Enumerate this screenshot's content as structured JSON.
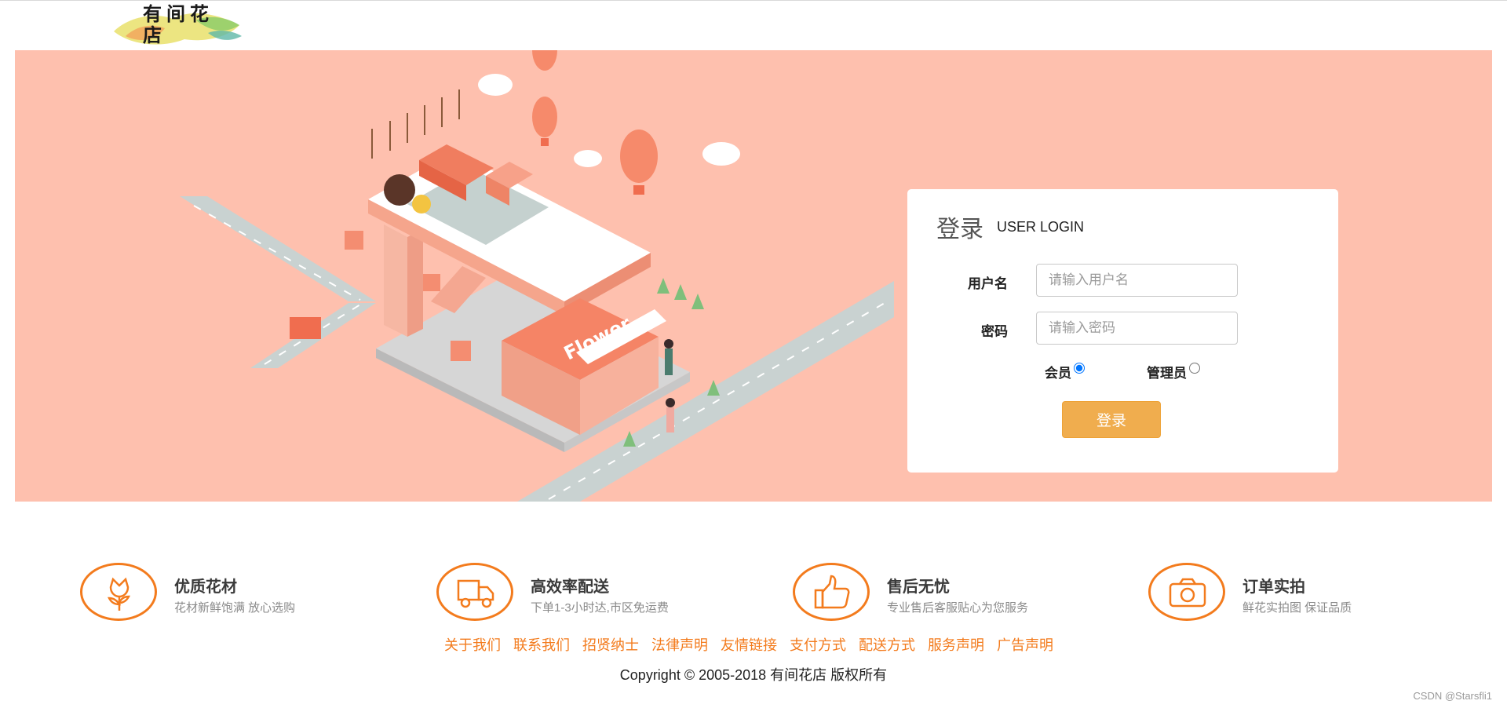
{
  "logo": {
    "text": "有间花店"
  },
  "login": {
    "title": "登录",
    "subtitle": "USER LOGIN",
    "username_label": "用户名",
    "username_placeholder": "请输入用户名",
    "password_label": "密码",
    "password_placeholder": "请输入密码",
    "role_member": "会员",
    "role_admin": "管理员",
    "role_selected": "会员",
    "submit_label": "登录"
  },
  "features": [
    {
      "title": "优质花材",
      "desc": "花材新鲜饱满 放心选购",
      "icon": "flower-icon"
    },
    {
      "title": "高效率配送",
      "desc": "下单1-3小时达,市区免运费",
      "icon": "delivery-truck-icon"
    },
    {
      "title": "售后无忧",
      "desc": "专业售后客服贴心为您服务",
      "icon": "thumbs-up-icon"
    },
    {
      "title": "订单实拍",
      "desc": "鲜花实拍图 保证品质",
      "icon": "camera-icon"
    }
  ],
  "footer": {
    "links": [
      "关于我们",
      "联系我们",
      "招贤纳士",
      "法律声明",
      "友情链接",
      "支付方式",
      "配送方式",
      "服务声明",
      "广告声明"
    ],
    "copyright": "Copyright © 2005-2018 有间花店 版权所有"
  },
  "watermark": "CSDN @Starsfli1",
  "colors": {
    "banner_bg": "#fec0ae",
    "accent": "#f37b1d",
    "button": "#f0ad4e"
  }
}
